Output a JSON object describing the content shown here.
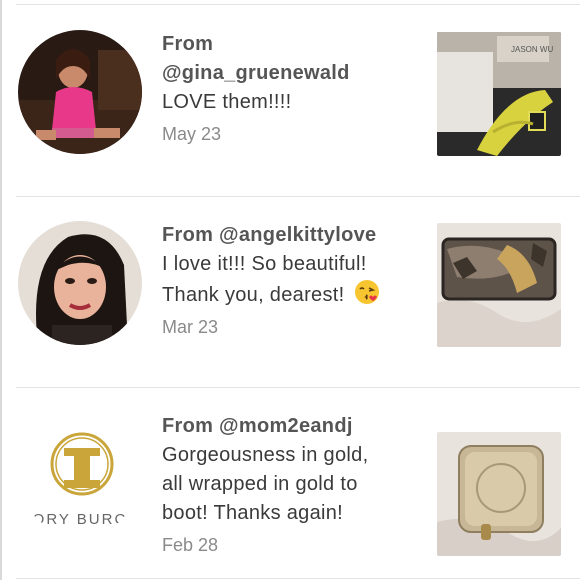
{
  "reviews": [
    {
      "from_label": "From",
      "username": "@gina_gruenewald",
      "comment_lines": [
        "LOVE them!!!!"
      ],
      "date": "May 23",
      "product": "yellow-flats-jason-wu-box",
      "box_text": "JASON WU"
    },
    {
      "from_line": "From @angelkittylove",
      "comment_lines": [
        "I love it!!! So beautiful!",
        "Thank you, dearest!"
      ],
      "emoji": "kissing-face-emoji",
      "date": "Mar 23",
      "product": "snakeskin-wallet"
    },
    {
      "from_line": "From @mom2eandj",
      "comment_lines": [
        "Gorgeousness in gold,",
        "all wrapped in gold to",
        "boot! Thanks again!"
      ],
      "date": "Feb 28",
      "product": "gold-wallet",
      "avatar_brand_text": "'ORY BURC'"
    }
  ],
  "colors": {
    "divider": "#e4e4e4",
    "text": "#3a3a3a",
    "date": "#8a8a8a",
    "logo_gold": "#c9a53a"
  }
}
